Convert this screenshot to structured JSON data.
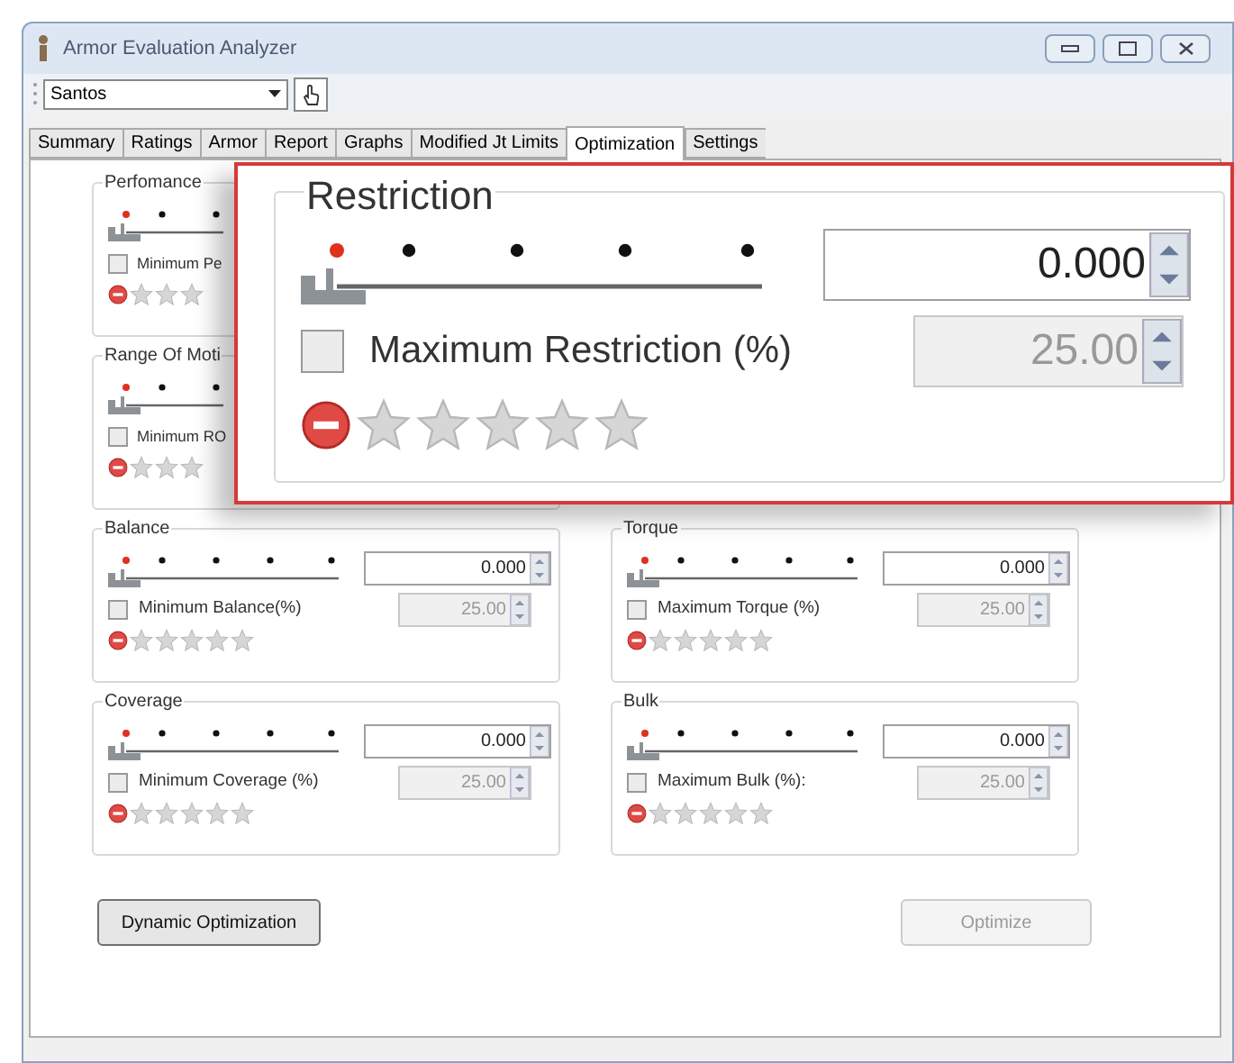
{
  "window": {
    "title": "Armor Evaluation Analyzer"
  },
  "toolbar": {
    "profile": "Santos"
  },
  "tabs": [
    {
      "label": "Summary",
      "selected": false
    },
    {
      "label": "Ratings",
      "selected": false
    },
    {
      "label": "Armor",
      "selected": false
    },
    {
      "label": "Report",
      "selected": false
    },
    {
      "label": "Graphs",
      "selected": false
    },
    {
      "label": "Modified Jt Limits",
      "selected": false
    },
    {
      "label": "Optimization",
      "selected": true
    },
    {
      "label": "Settings",
      "selected": false
    }
  ],
  "covered_groups": [
    {
      "title": "Perfomance",
      "level": 0,
      "checkbox_label": "Minimum Pe",
      "checked": false,
      "stars": 0
    },
    {
      "title": "Range Of Moti",
      "level": 0,
      "checkbox_label": "Minimum RO",
      "checked": false,
      "stars": 0
    }
  ],
  "magnifier": {
    "title": "Restriction",
    "level": 0,
    "value": "0.000",
    "checkbox_label": "Maximum Restriction (%)",
    "checked": false,
    "limit": "25.00",
    "stars": 0
  },
  "groups": [
    {
      "title": "Balance",
      "level": 0,
      "value": "0.000",
      "checkbox_label": "Minimum Balance(%)",
      "checked": false,
      "limit": "25.00",
      "stars": 0
    },
    {
      "title": "Torque",
      "level": 0,
      "value": "0.000",
      "checkbox_label": "Maximum Torque (%)",
      "checked": false,
      "limit": "25.00",
      "stars": 0
    },
    {
      "title": "Coverage",
      "level": 0,
      "value": "0.000",
      "checkbox_label": "Minimum Coverage (%)",
      "checked": false,
      "limit": "25.00",
      "stars": 0
    },
    {
      "title": "Bulk",
      "level": 0,
      "value": "0.000",
      "checkbox_label": "Maximum Bulk (%):",
      "checked": false,
      "limit": "25.00",
      "stars": 0
    }
  ],
  "buttons": [
    {
      "label": "Dynamic Optimization",
      "disabled": false
    },
    {
      "label": "Optimize",
      "disabled": true
    }
  ]
}
